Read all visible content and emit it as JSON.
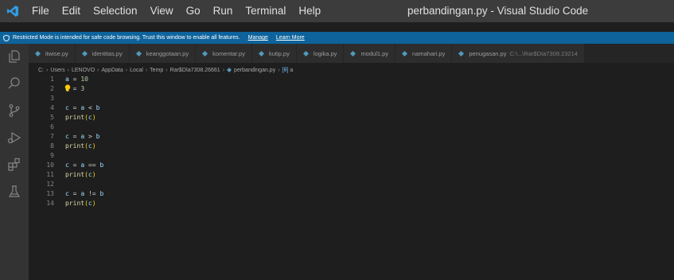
{
  "titlebar": {
    "app_icon": "vscode-logo",
    "menu": [
      "File",
      "Edit",
      "Selection",
      "View",
      "Go",
      "Run",
      "Terminal",
      "Help"
    ],
    "window_title": "perbandingan.py - Visual Studio Code"
  },
  "banner": {
    "icon": "shield-icon",
    "message": "Restricted Mode is intended for safe code browsing. Trust this window to enable all features.",
    "manage_label": "Manage",
    "learn_more_label": "Learn More"
  },
  "activity_bar": [
    "files-icon",
    "search-icon",
    "source-control-icon",
    "run-debug-icon",
    "extensions-icon",
    "testing-icon"
  ],
  "tabs": [
    {
      "label": "itwise.py",
      "desc": ""
    },
    {
      "label": "identitas.py",
      "desc": ""
    },
    {
      "label": "keanggotaan.py",
      "desc": ""
    },
    {
      "label": "komentar.py",
      "desc": ""
    },
    {
      "label": "kutip.py",
      "desc": ""
    },
    {
      "label": "logika.py",
      "desc": ""
    },
    {
      "label": "modul1.py",
      "desc": ""
    },
    {
      "label": "namahari.py",
      "desc": ""
    },
    {
      "label": "penugasan.py",
      "desc": "C:\\...\\Rar$DIa7308.23214"
    }
  ],
  "breadcrumb": {
    "parts": [
      "C:",
      "Users",
      "LENOVO",
      "AppData",
      "Local",
      "Temp",
      "Rar$DIa7308.26661",
      "perbandingan.py"
    ],
    "symbol": "a",
    "symbol_icon": "[θ]"
  },
  "editor": {
    "lines": [
      {
        "n": "1",
        "code": "a = 10"
      },
      {
        "n": "2",
        "code": "b = 3"
      },
      {
        "n": "3",
        "code": ""
      },
      {
        "n": "4",
        "code": "c = a < b"
      },
      {
        "n": "5",
        "code": "print(c)"
      },
      {
        "n": "6",
        "code": ""
      },
      {
        "n": "7",
        "code": "c = a > b"
      },
      {
        "n": "8",
        "code": "print(c)"
      },
      {
        "n": "9",
        "code": ""
      },
      {
        "n": "10",
        "code": "c = a == b"
      },
      {
        "n": "11",
        "code": "print(c)"
      },
      {
        "n": "12",
        "code": ""
      },
      {
        "n": "13",
        "code": "c = a != b"
      },
      {
        "n": "14",
        "code": "print(c)"
      }
    ]
  },
  "colors": {
    "accent_blue": "#0e639c",
    "python_icon": "#519aba",
    "lightbulb": "#ffcc00"
  }
}
